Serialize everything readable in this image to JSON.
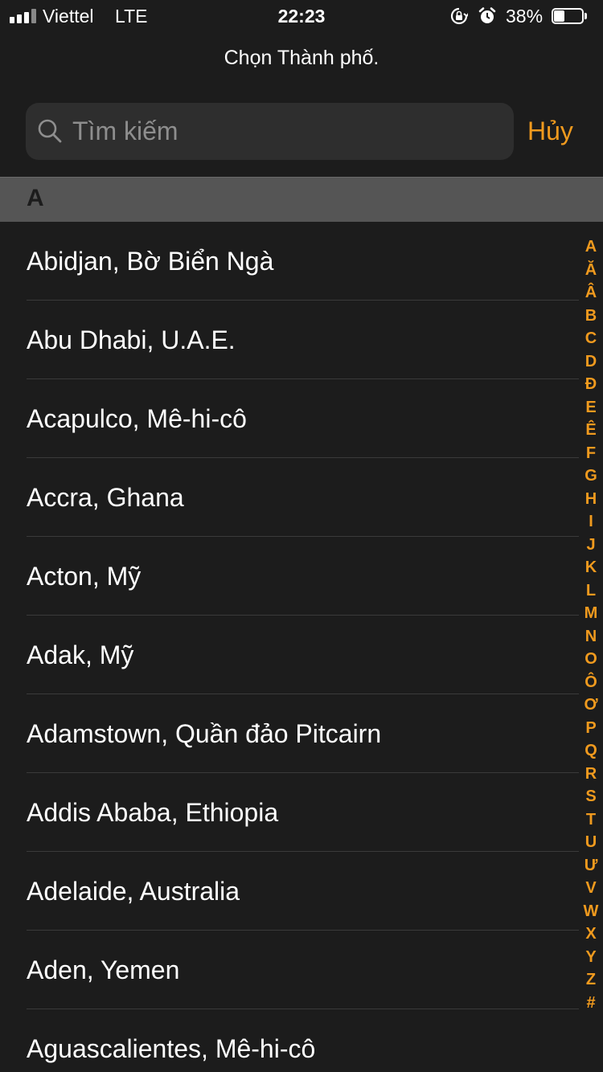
{
  "status_bar": {
    "carrier": "Viettel",
    "network": "LTE",
    "time": "22:23",
    "battery_percent_label": "38%",
    "battery_level": 0.38,
    "signal_bars": 4,
    "icons": [
      "rotation-lock-icon",
      "alarm-icon",
      "battery-icon"
    ]
  },
  "header": {
    "title": "Chọn Thành phố."
  },
  "search": {
    "placeholder": "Tìm kiếm",
    "value": "",
    "cancel_label": "Hủy",
    "icon": "search-icon"
  },
  "section": {
    "letter": "A"
  },
  "cities": [
    "Abidjan, Bờ Biển Ngà",
    "Abu Dhabi, U.A.E.",
    "Acapulco, Mê-hi-cô",
    "Accra, Ghana",
    "Acton, Mỹ",
    "Adak, Mỹ",
    "Adamstown, Quần đảo Pitcairn",
    "Addis Ababa, Ethiopia",
    "Adelaide, Australia",
    "Aden, Yemen",
    "Aguascalientes, Mê-hi-cô"
  ],
  "index_letters": [
    "A",
    "Ă",
    "Â",
    "B",
    "C",
    "D",
    "Đ",
    "E",
    "Ê",
    "F",
    "G",
    "H",
    "I",
    "J",
    "K",
    "L",
    "M",
    "N",
    "O",
    "Ô",
    "Ơ",
    "P",
    "Q",
    "R",
    "S",
    "T",
    "U",
    "Ư",
    "V",
    "W",
    "X",
    "Y",
    "Z",
    "#"
  ],
  "colors": {
    "accent": "#f09a1e",
    "background": "#1c1c1c",
    "search_background": "#2e2e2e",
    "section_background": "#555555",
    "placeholder": "#8e8e8e"
  }
}
